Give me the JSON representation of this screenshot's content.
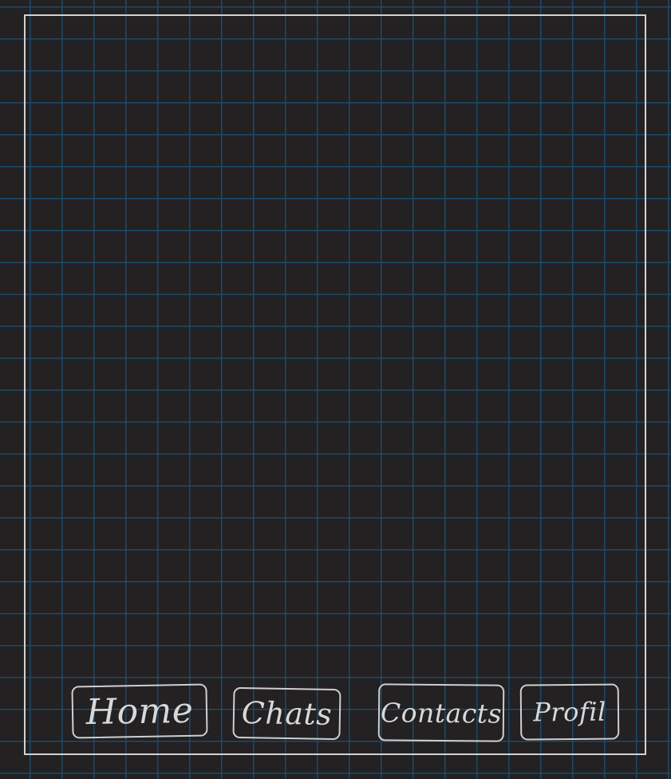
{
  "canvas": {
    "grid_color": "#1b4a6e",
    "background_color": "#232121",
    "stroke_color": "#d2d2d2"
  },
  "nav": {
    "items": [
      {
        "label": "Home"
      },
      {
        "label": "Chats"
      },
      {
        "label": "Contacts"
      },
      {
        "label": "Profil"
      }
    ]
  }
}
